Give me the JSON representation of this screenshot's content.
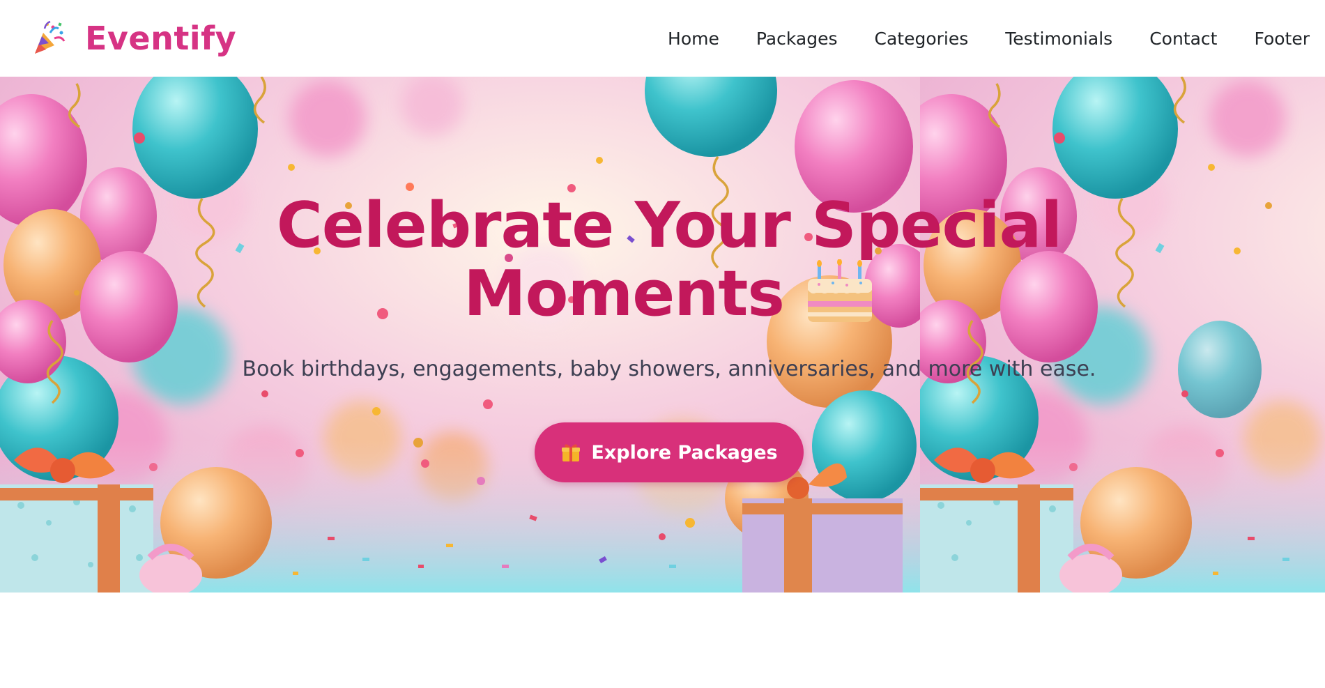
{
  "brand": {
    "name": "Eventify",
    "icon": "party-popper-icon"
  },
  "nav": {
    "items": [
      {
        "label": "Home"
      },
      {
        "label": "Packages"
      },
      {
        "label": "Categories"
      },
      {
        "label": "Testimonials"
      },
      {
        "label": "Contact"
      },
      {
        "label": "Footer"
      }
    ]
  },
  "hero": {
    "title": "Celebrate Your Special Moments",
    "title_icon": "birthday-cake-icon",
    "subtitle": "Book birthdays, engagements, baby showers, anniversaries, and more with ease.",
    "cta_label": "Explore Packages",
    "cta_icon": "gift-icon",
    "background": "balloons-and-gifts-party-photo"
  },
  "colors": {
    "brand": "#d63384",
    "title": "#c2185b",
    "cta_bg": "#d8307a",
    "nav_text": "#212529",
    "subtitle_text": "#3d3f52"
  }
}
